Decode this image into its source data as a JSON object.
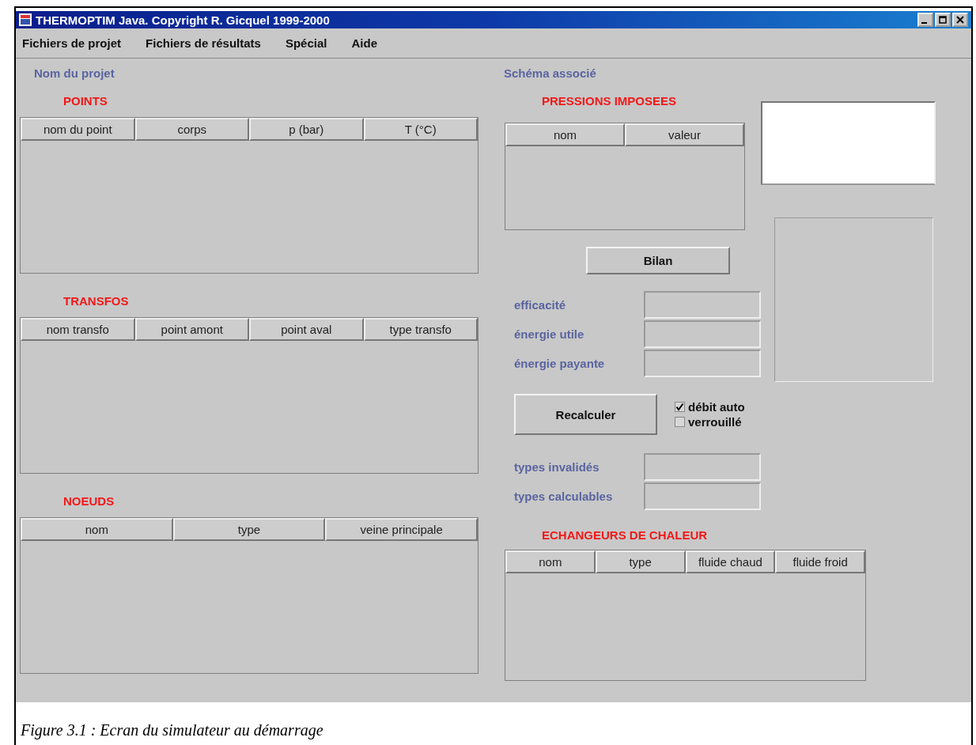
{
  "window": {
    "title": "THERMOPTIM Java. Copyright R. Gicquel 1999-2000"
  },
  "menu": [
    "Fichiers de projet",
    "Fichiers de résultats",
    "Spécial",
    "Aide"
  ],
  "project_label": "Nom du projet",
  "schema_label": "Schéma associé",
  "left_tables": [
    {
      "title": "POINTS",
      "columns": [
        "nom du point",
        "corps",
        "p (bar)",
        "T (°C)"
      ]
    },
    {
      "title": "TRANSFOS",
      "columns": [
        "nom transfo",
        "point amont",
        "point aval",
        "type transfo"
      ]
    },
    {
      "title": "NOEUDS",
      "columns": [
        "nom",
        "type",
        "veine principale"
      ]
    }
  ],
  "pressions": {
    "title": "PRESSIONS IMPOSEES",
    "columns": [
      "nom",
      "valeur"
    ]
  },
  "bilan_button": "Bilan",
  "result_fields": [
    {
      "label": "efficacité"
    },
    {
      "label": "énergie utile"
    },
    {
      "label": "énergie payante"
    }
  ],
  "recalculer_button": "Recalculer",
  "checkboxes": [
    {
      "label": "débit auto",
      "checked": true
    },
    {
      "label": "verrouillé",
      "checked": false
    }
  ],
  "type_fields": [
    {
      "label": "types invalidés"
    },
    {
      "label": "types calculables"
    }
  ],
  "echangeurs": {
    "title": "ECHANGEURS DE CHALEUR",
    "columns": [
      "nom",
      "type",
      "fluide chaud",
      "fluide froid"
    ]
  },
  "caption": "Figure 3.1 : Ecran du simulateur au démarrage"
}
